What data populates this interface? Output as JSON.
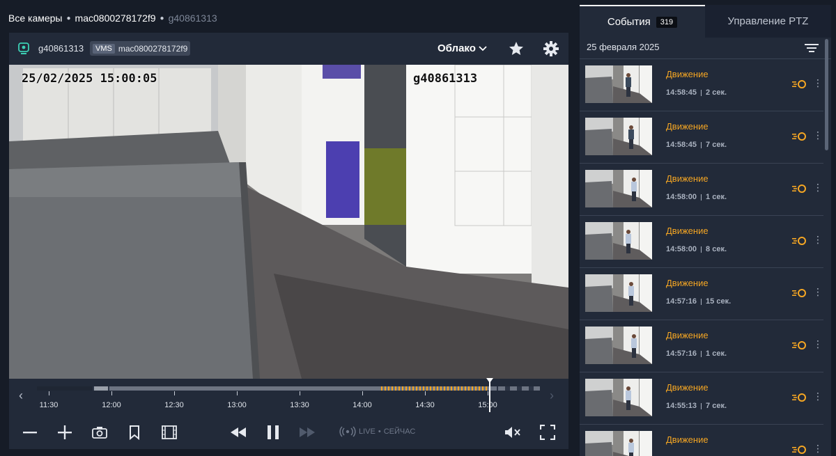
{
  "breadcrumb": {
    "root": "Все камеры",
    "group": "mac0800278172f9",
    "camera": "g40861313"
  },
  "player": {
    "camera_name": "g40861313",
    "vms_tag": "VMS",
    "vms_id": "mac0800278172f9",
    "storage_select": "Облако",
    "osd_timestamp": "25/02/2025 15:00:05",
    "osd_name": "g40861313"
  },
  "timeline": {
    "labels": [
      "11:30",
      "12:00",
      "12:30",
      "13:00",
      "13:30",
      "14:00",
      "14:30",
      "15:00"
    ],
    "current": "15:00"
  },
  "controls": {
    "live_label": "LIVE",
    "live_now": "СЕЙЧАС"
  },
  "sidebar": {
    "tab_events": "События",
    "events_count": "319",
    "tab_ptz": "Управление PTZ",
    "date": "25 февраля 2025",
    "events": [
      {
        "type": "Движение",
        "time": "14:58:45",
        "duration": "2 сек."
      },
      {
        "type": "Движение",
        "time": "14:58:45",
        "duration": "7 сек."
      },
      {
        "type": "Движение",
        "time": "14:58:00",
        "duration": "1 сек."
      },
      {
        "type": "Движение",
        "time": "14:58:00",
        "duration": "8 сек."
      },
      {
        "type": "Движение",
        "time": "14:57:16",
        "duration": "15 сек."
      },
      {
        "type": "Движение",
        "time": "14:57:16",
        "duration": "1 сек."
      },
      {
        "type": "Движение",
        "time": "14:55:13",
        "duration": "7 сек."
      },
      {
        "type": "Движение",
        "time": "",
        "duration": ""
      }
    ]
  },
  "colors": {
    "accent_motion": "#f5a623",
    "panel": "#222a39",
    "background": "#161c27"
  }
}
